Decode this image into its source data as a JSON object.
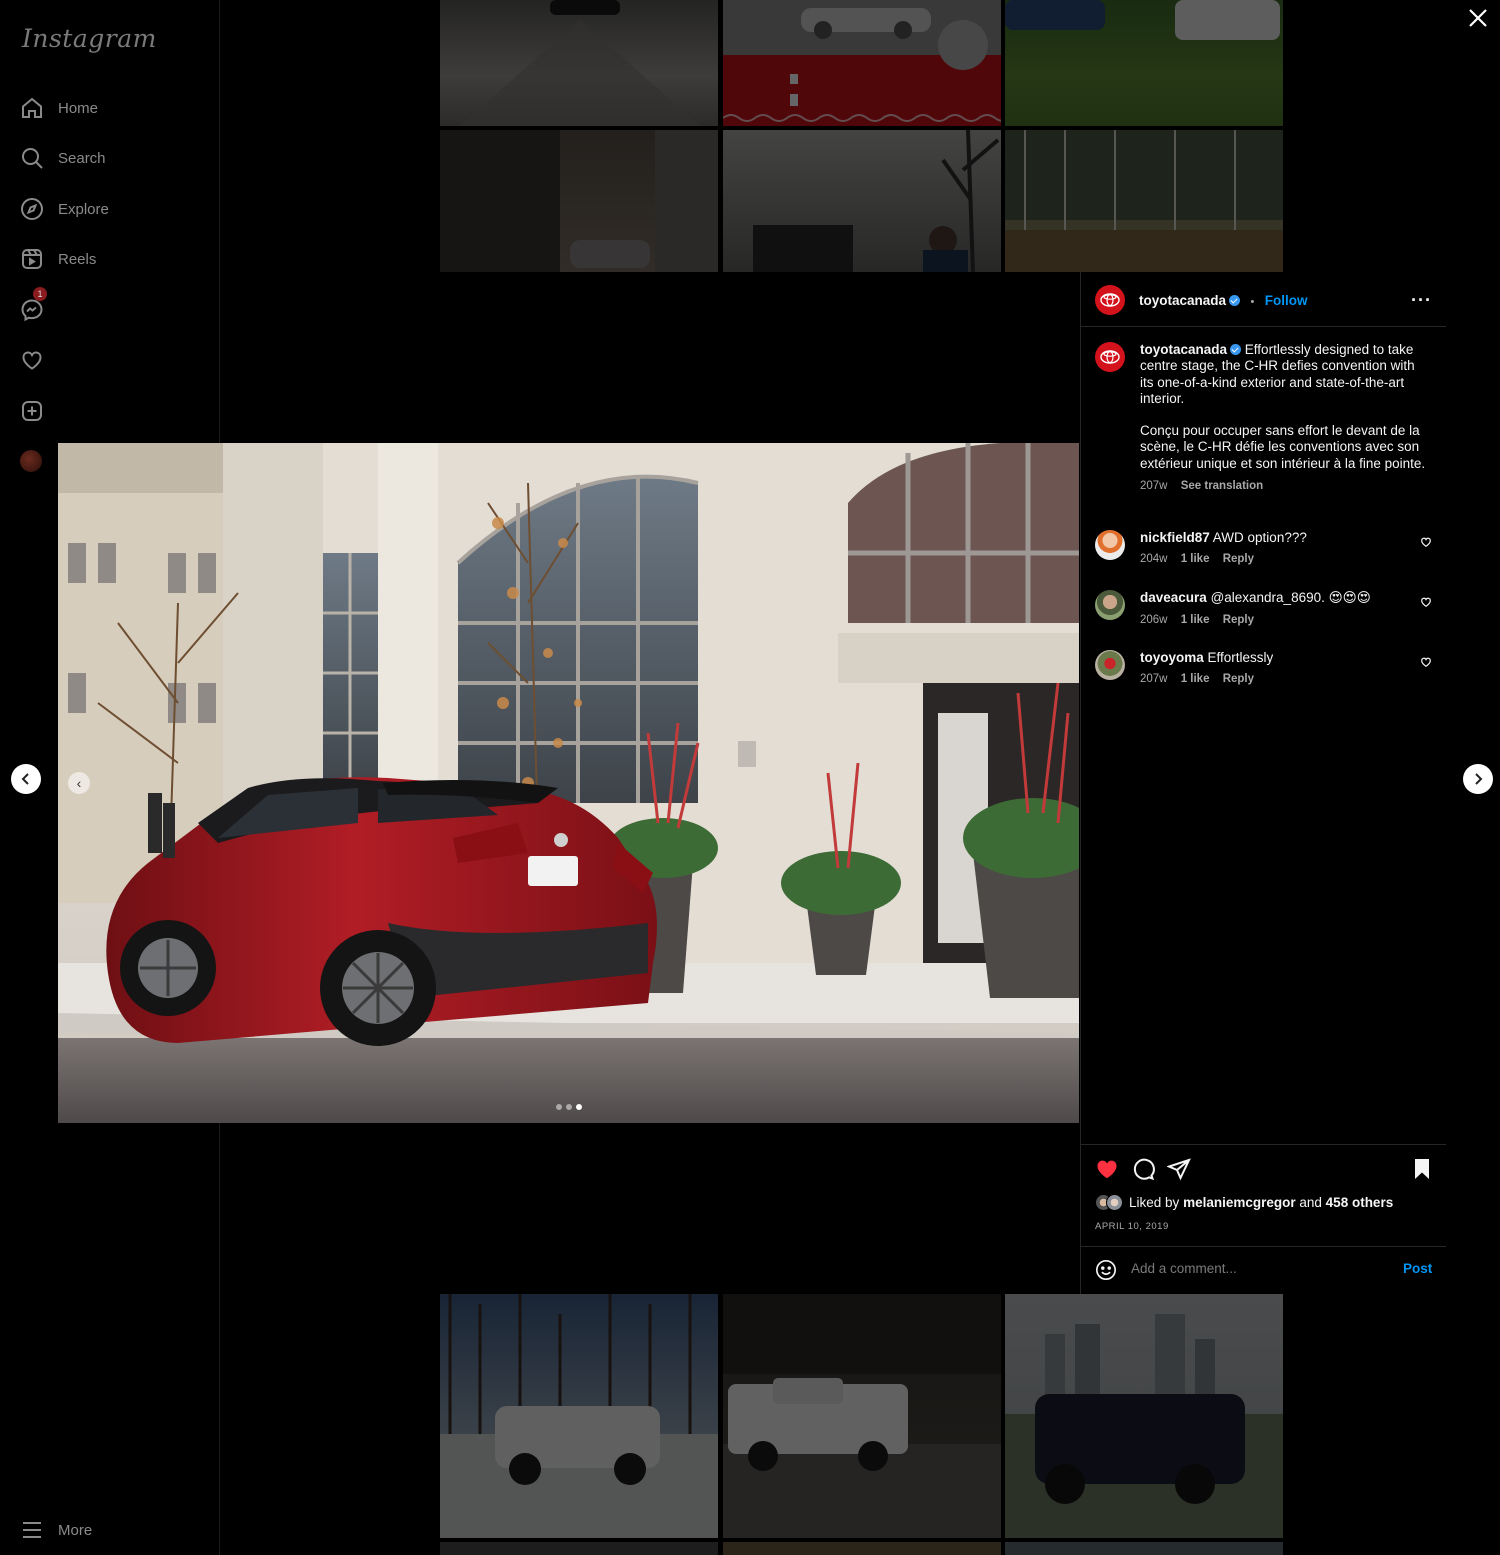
{
  "app": {
    "logo": "Instagram"
  },
  "sidebar": {
    "items": [
      {
        "label": "Home",
        "icon": "home-icon"
      },
      {
        "label": "Search",
        "icon": "search-icon"
      },
      {
        "label": "Explore",
        "icon": "explore-icon"
      },
      {
        "label": "Reels",
        "icon": "reels-icon"
      }
    ],
    "messages_badge": "1",
    "more_label": "More"
  },
  "post": {
    "author": "toyotacanada",
    "follow_label": "Follow",
    "separator": "•",
    "caption": {
      "en": "Effortlessly designed to take centre stage, the C-HR defies convention with its one-of-a-kind exterior and state-of-the-art interior.",
      "fr": "Conçu pour occuper sans effort le devant de la scène, le C-HR défie les conventions avec son extérieur unique et son intérieur à la fine pointe."
    },
    "caption_time": "207w",
    "see_translation": "See translation",
    "carousel": {
      "slides": 3,
      "active_index": 2
    }
  },
  "comments": [
    {
      "user": "nickfield87",
      "text": "AWD option???",
      "time": "204w",
      "likes": "1 like",
      "reply": "Reply"
    },
    {
      "user": "daveacura",
      "text": "@alexandra_8690. 😍😍😍",
      "time": "206w",
      "likes": "1 like",
      "reply": "Reply"
    },
    {
      "user": "toyoyoma",
      "text": "Effortlessly",
      "time": "207w",
      "likes": "1 like",
      "reply": "Reply"
    }
  ],
  "likes": {
    "prefix": "Liked by",
    "user": "melaniemcgregor",
    "middle": "and",
    "others": "458 others"
  },
  "post_date": "APRIL 10, 2019",
  "comment_box": {
    "placeholder": "Add a comment...",
    "post_label": "Post"
  },
  "colors": {
    "accent": "#0095f6",
    "like": "#ff3040",
    "brand": "#d3121c"
  }
}
